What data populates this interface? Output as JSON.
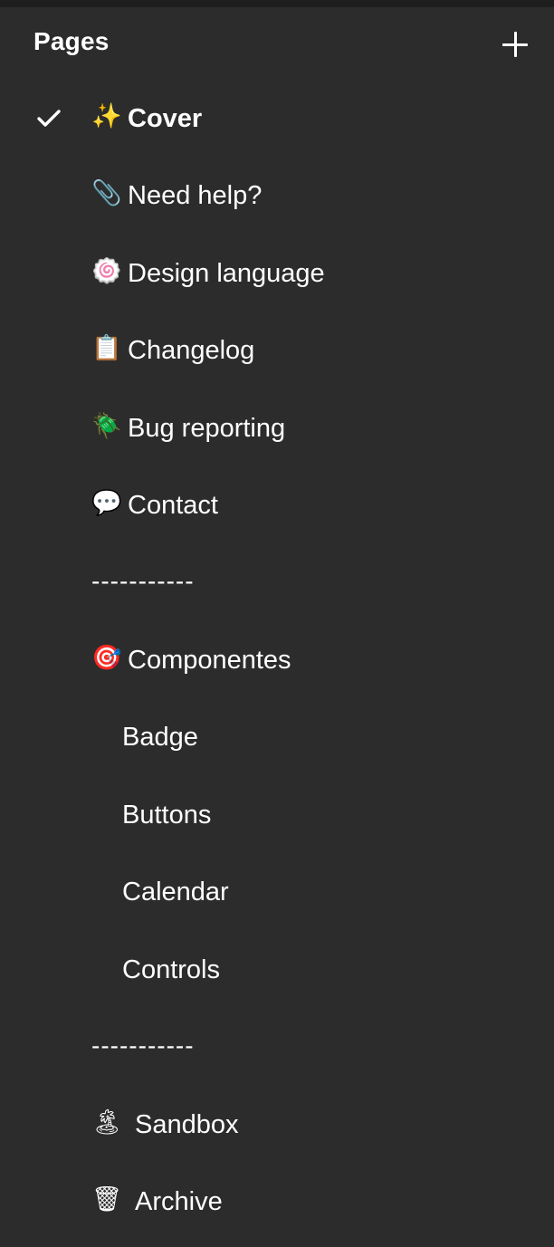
{
  "header": {
    "title": "Pages"
  },
  "pages": [
    {
      "emoji": "✨",
      "label": "Cover",
      "selected": true
    },
    {
      "emoji": "📎",
      "label": "Need help?"
    },
    {
      "emoji": "🍥",
      "label": "Design language"
    },
    {
      "emoji": "📋",
      "label": "Changelog"
    },
    {
      "emoji": "🪲",
      "label": "Bug reporting"
    },
    {
      "emoji": "💬",
      "label": "Contact"
    },
    {
      "separator": "-----------"
    },
    {
      "emoji": "🎯",
      "label": "Componentes"
    },
    {
      "label": "Badge",
      "indent": true
    },
    {
      "label": "Buttons",
      "indent": true
    },
    {
      "label": "Calendar",
      "indent": true
    },
    {
      "label": "Controls",
      "indent": true
    },
    {
      "separator": "-----------"
    },
    {
      "emoji": "🏝",
      "label": "Sandbox"
    },
    {
      "emoji": "🗑",
      "label": "Archive"
    }
  ],
  "icons": {
    "add": "plus-icon",
    "selected": "checkmark-icon"
  }
}
